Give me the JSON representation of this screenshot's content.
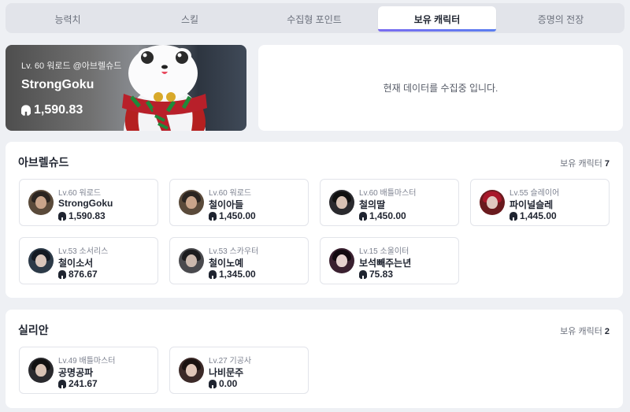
{
  "tabs": [
    {
      "label": "능력치"
    },
    {
      "label": "스킬"
    },
    {
      "label": "수집형 포인트"
    },
    {
      "label": "보유 캐릭터"
    },
    {
      "label": "증명의 전장"
    }
  ],
  "active_tab": "보유 캐릭터",
  "hero": {
    "subtitle": "Lv. 60 워로드 @아브렐슈드",
    "name": "StrongGoku",
    "power": "1,590.83",
    "icon": "helmet-icon"
  },
  "collecting_message": "현재 데이터를 수집중 입니다.",
  "servers": [
    {
      "name": "아브렐슈드",
      "count_label": "보유 캐릭터",
      "count": "7",
      "characters": [
        {
          "level": "Lv.60 워로드",
          "name": "StrongGoku",
          "power": "1,590.83"
        },
        {
          "level": "Lv.60 워로드",
          "name": "철이아들",
          "power": "1,450.00"
        },
        {
          "level": "Lv.60 배틀마스터",
          "name": "철의딸",
          "power": "1,450.00"
        },
        {
          "level": "Lv.55 슬레이어",
          "name": "파이널슬레",
          "power": "1,445.00"
        },
        {
          "level": "Lv.53 소서리스",
          "name": "철이소서",
          "power": "876.67"
        },
        {
          "level": "Lv.53 스카우터",
          "name": "철이노예",
          "power": "1,345.00"
        },
        {
          "level": "Lv.15 소울이터",
          "name": "보석빼주는년",
          "power": "75.83"
        }
      ]
    },
    {
      "name": "실리안",
      "count_label": "보유 캐릭터",
      "count": "2",
      "characters": [
        {
          "level": "Lv.49 배틀마스터",
          "name": "공명공파",
          "power": "241.67"
        },
        {
          "level": "Lv.27 기공사",
          "name": "나비문주",
          "power": "0.00"
        }
      ]
    }
  ],
  "colors": {
    "accent_start": "#7a6cf0",
    "accent_end": "#5b7ef0",
    "background": "#eef0f4"
  }
}
